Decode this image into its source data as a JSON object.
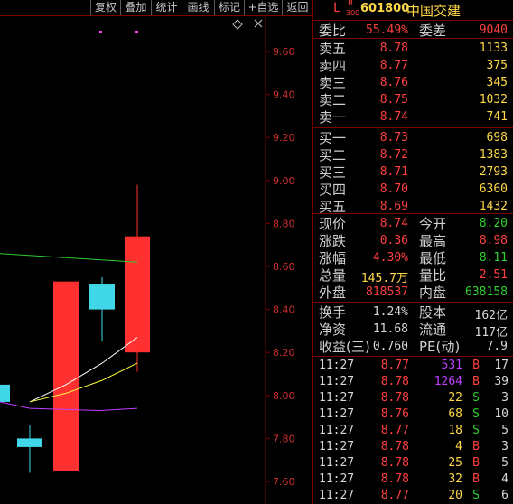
{
  "toolbar": {
    "buttons": [
      "复权",
      "叠加",
      "统计",
      "画线",
      "标记",
      "+自选",
      "返回"
    ]
  },
  "header": {
    "market_letter": "L",
    "r_badge": "R",
    "r_sub": "300",
    "code": "601800",
    "name": "中国交建"
  },
  "ratio": {
    "wb_label": "委比",
    "wb_value": "55.49%",
    "wc_label": "委差",
    "wc_value": "9040"
  },
  "asks": [
    {
      "label": "卖五",
      "price": "8.78",
      "vol": "1133"
    },
    {
      "label": "卖四",
      "price": "8.77",
      "vol": "375"
    },
    {
      "label": "卖三",
      "price": "8.76",
      "vol": "345"
    },
    {
      "label": "卖二",
      "price": "8.75",
      "vol": "1032"
    },
    {
      "label": "卖一",
      "price": "8.74",
      "vol": "741"
    }
  ],
  "bids": [
    {
      "label": "买一",
      "price": "8.73",
      "vol": "698"
    },
    {
      "label": "买二",
      "price": "8.72",
      "vol": "1383"
    },
    {
      "label": "买三",
      "price": "8.71",
      "vol": "2793"
    },
    {
      "label": "买四",
      "price": "8.70",
      "vol": "6360"
    },
    {
      "label": "买五",
      "price": "8.69",
      "vol": "1432"
    }
  ],
  "quote": [
    {
      "l1": "现价",
      "v1": "8.74",
      "c1": "red",
      "l2": "今开",
      "v2": "8.20",
      "c2": "grn"
    },
    {
      "l1": "涨跌",
      "v1": "0.36",
      "c1": "red",
      "l2": "最高",
      "v2": "8.98",
      "c2": "red"
    },
    {
      "l1": "涨幅",
      "v1": "4.30%",
      "c1": "red",
      "l2": "最低",
      "v2": "8.11",
      "c2": "grn"
    },
    {
      "l1": "总量",
      "v1": "145.7万",
      "c1": "yel",
      "l2": "量比",
      "v2": "2.51",
      "c2": "red"
    },
    {
      "l1": "外盘",
      "v1": "818537",
      "c1": "red",
      "l2": "内盘",
      "v2": "638158",
      "c2": "grn"
    }
  ],
  "fundamentals": [
    {
      "l1": "换手",
      "v1": "1.24%",
      "l2": "股本",
      "v2": "162亿"
    },
    {
      "l1": "净资",
      "v1": "11.68",
      "l2": "流通",
      "v2": "117亿"
    },
    {
      "l1": "收益(三)",
      "v1": "0.760",
      "l2": "PE(动)",
      "v2": "7.9"
    }
  ],
  "ticks": [
    {
      "time": "11:27",
      "price": "8.77",
      "vol": "531",
      "vc": "pur",
      "side": "B",
      "count": "17"
    },
    {
      "time": "11:27",
      "price": "8.78",
      "vol": "1264",
      "vc": "pur",
      "side": "B",
      "count": "39"
    },
    {
      "time": "11:27",
      "price": "8.78",
      "vol": "22",
      "vc": "yel",
      "side": "S",
      "count": "3"
    },
    {
      "time": "11:27",
      "price": "8.76",
      "vol": "68",
      "vc": "yel",
      "side": "S",
      "count": "10"
    },
    {
      "time": "11:27",
      "price": "8.77",
      "vol": "18",
      "vc": "yel",
      "side": "S",
      "count": "5"
    },
    {
      "time": "11:27",
      "price": "8.78",
      "vol": "4",
      "vc": "yel",
      "side": "B",
      "count": "3"
    },
    {
      "time": "11:27",
      "price": "8.78",
      "vol": "25",
      "vc": "yel",
      "side": "B",
      "count": "5"
    },
    {
      "time": "11:27",
      "price": "8.78",
      "vol": "32",
      "vc": "yel",
      "side": "B",
      "count": "4"
    },
    {
      "time": "11:27",
      "price": "8.77",
      "vol": "20",
      "vc": "yel",
      "side": "S",
      "count": "6"
    }
  ],
  "chart_data": {
    "type": "candlestick",
    "y_ticks": [
      "9.60",
      "9.40",
      "9.20",
      "9.00",
      "8.80",
      "8.60",
      "8.40",
      "8.20",
      "8.00",
      "7.80",
      "7.60"
    ],
    "ylim": [
      7.6,
      9.6
    ],
    "candles": [
      {
        "open": 8.05,
        "close": 7.97,
        "high": 8.05,
        "low": 7.97,
        "color": "cyan"
      },
      {
        "open": 7.8,
        "close": 7.76,
        "high": 7.86,
        "low": 7.64,
        "color": "cyan"
      },
      {
        "open": 7.65,
        "close": 8.53,
        "high": 8.53,
        "low": 7.65,
        "color": "red"
      },
      {
        "open": 8.52,
        "close": 8.4,
        "high": 8.55,
        "low": 8.25,
        "color": "cyan"
      },
      {
        "open": 8.2,
        "close": 8.74,
        "high": 8.98,
        "low": 8.11,
        "color": "red"
      }
    ],
    "ma_lines": [
      {
        "color": "#30d030",
        "points": [
          [
            8.66,
            8.62
          ]
        ]
      },
      {
        "color": "#ffffff",
        "points": [
          7.97,
          8.05,
          8.15,
          8.27
        ]
      },
      {
        "color": "#ffff40",
        "points": [
          7.97,
          8.01,
          8.07,
          8.15
        ]
      },
      {
        "color": "#c040ff",
        "points": [
          7.94,
          7.93,
          7.94
        ]
      }
    ],
    "colors": {
      "up": "#ff3030",
      "down": "#40d8e8",
      "grid": "#7a0000"
    }
  }
}
